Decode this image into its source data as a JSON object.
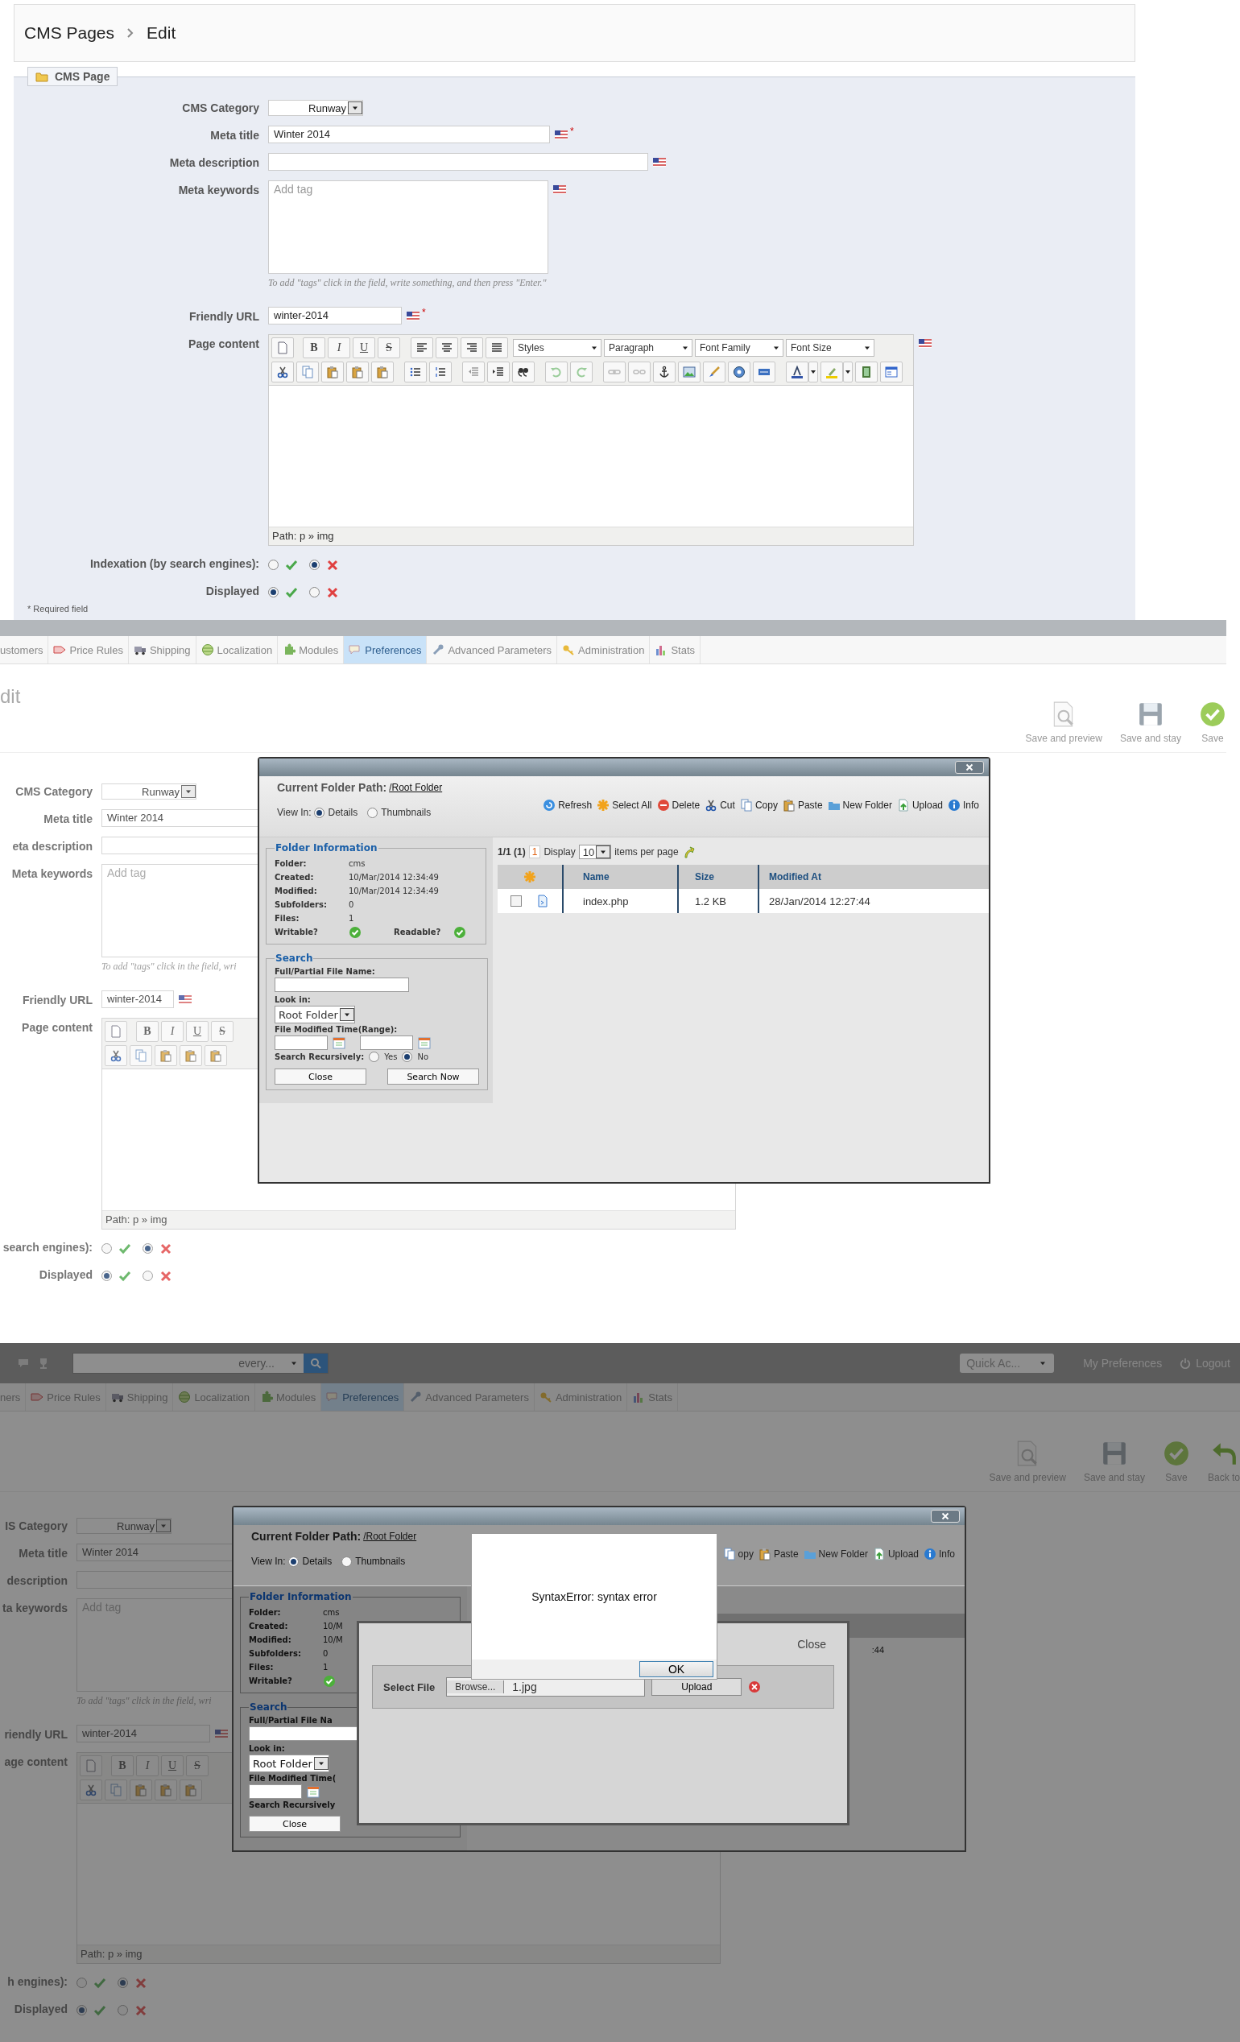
{
  "screens": [
    {
      "kind": "plain",
      "breadcrumb": [
        {
          "label": "CMS Pages"
        },
        {
          "label": "Edit"
        }
      ],
      "legend": "CMS Page",
      "form": {
        "category": {
          "label": "CMS Category",
          "value": "Runway"
        },
        "meta_title": {
          "label": "Meta title",
          "value": "Winter 2014",
          "required_mark": "*"
        },
        "meta_description": {
          "label": "Meta description"
        },
        "meta_keywords": {
          "label": "Meta keywords",
          "placeholder": "Add tag",
          "hint": "To add \"tags\" click in the field, write something, and then press \"Enter.\""
        },
        "friendly_url": {
          "label": "Friendly URL",
          "value": "winter-2014",
          "required_mark": "*"
        },
        "page_content": {
          "label": "Page content",
          "letters": [
            "B",
            "I",
            "U",
            "S"
          ],
          "formats": [
            "Styles",
            "Paragraph",
            "Font Family",
            "Font Size"
          ],
          "path": "Path: p » img"
        },
        "switches": [
          {
            "label": "Indexation (by search engines):",
            "options": [
              {
                "kind": "yes",
                "selected": false
              },
              {
                "kind": "no",
                "selected": true
              }
            ]
          },
          {
            "label": "Displayed",
            "options": [
              {
                "kind": "yes",
                "selected": true
              },
              {
                "kind": "no",
                "selected": false
              }
            ]
          }
        ]
      },
      "required_note": "* Required field"
    },
    {
      "kind": "light",
      "tabs": [
        {
          "label": "ustomers",
          "selected": false
        },
        {
          "label": "Price Rules",
          "selected": false
        },
        {
          "label": "Shipping",
          "selected": false
        },
        {
          "label": "Localization",
          "selected": false
        },
        {
          "label": "Modules",
          "selected": false
        },
        {
          "label": "Preferences",
          "selected": true
        },
        {
          "label": "Advanced Parameters",
          "selected": false
        },
        {
          "label": "Administration",
          "selected": false
        },
        {
          "label": "Stats",
          "selected": false
        }
      ],
      "title": "dit",
      "actions": [
        {
          "label": "Save and preview",
          "kind": "preview"
        },
        {
          "label": "Save and stay",
          "kind": "stay"
        },
        {
          "label": "Save",
          "kind": "save"
        }
      ],
      "form": {
        "category": {
          "label": "CMS Category",
          "value": "Runway"
        },
        "meta_title": {
          "label": "Meta title",
          "value": "Winter 2014"
        },
        "meta_description": {
          "label": "eta description"
        },
        "meta_keywords": {
          "label": "Meta keywords",
          "placeholder": "Add tag",
          "hint": "To add \"tags\" click in the field, wri"
        },
        "friendly_url": {
          "label": "Friendly URL",
          "value": "winter-2014"
        },
        "page_content": {
          "label": "Page content",
          "letters": [
            "B",
            "I",
            "U",
            "S"
          ],
          "path": "Path: p » img"
        },
        "switches": [
          {
            "label": "search engines):",
            "options": [
              {
                "kind": "yes",
                "selected": false
              },
              {
                "kind": "no",
                "selected": true
              }
            ]
          },
          {
            "label": "Displayed",
            "options": [
              {
                "kind": "yes",
                "selected": true
              },
              {
                "kind": "no",
                "selected": false
              }
            ]
          }
        ]
      },
      "file_manager": {
        "path_label": "Current Folder Path:",
        "path_link": "/Root Folder",
        "view_in": {
          "label": "View In:",
          "options": [
            {
              "label": "Details",
              "selected": true
            },
            {
              "label": "Thumbnails",
              "selected": false
            }
          ]
        },
        "actions": [
          {
            "label": "Refresh",
            "kind": "refresh"
          },
          {
            "label": "Select All",
            "kind": "select_all"
          },
          {
            "label": "Delete",
            "kind": "delete"
          },
          {
            "label": "Cut",
            "kind": "cut"
          },
          {
            "label": "Copy",
            "kind": "copy"
          },
          {
            "label": "Paste",
            "kind": "paste"
          },
          {
            "label": "New Folder",
            "kind": "new_folder"
          },
          {
            "label": "Upload",
            "kind": "upload"
          },
          {
            "label": "Info",
            "kind": "info"
          }
        ],
        "folder_info": {
          "title": "Folder Information",
          "rows": [
            {
              "label": "Folder:",
              "value": "cms"
            },
            {
              "label": "Created:",
              "value": "10/Mar/2014 12:34:49"
            },
            {
              "label": "Modified:",
              "value": "10/Mar/2014 12:34:49"
            },
            {
              "label": "Subfolders:",
              "value": "0"
            },
            {
              "label": "Files:",
              "value": "1"
            }
          ],
          "writable": "Writable?",
          "readable": "Readable?"
        },
        "search": {
          "title": "Search",
          "name_label": "Full/Partial File Name:",
          "look_in_label": "Look in:",
          "look_in_value": "Root Folder",
          "time_label": "File Modified Time(Range):",
          "recursive_label": "Search Recursively:",
          "recursive_options": [
            {
              "label": "Yes",
              "selected": false
            },
            {
              "label": "No",
              "selected": true
            }
          ],
          "buttons": [
            "Close",
            "Search Now"
          ]
        },
        "pager": {
          "count": "1/1 (1)",
          "page": "1",
          "display": "Display",
          "per_page": "10",
          "suffix": "items per page"
        },
        "columns": [
          "Name",
          "Size",
          "Modified At"
        ],
        "rows": [
          {
            "checked": false,
            "name": "index.php",
            "size": "1.2 KB",
            "modified": "28/Jan/2014 12:27:44"
          }
        ]
      }
    },
    {
      "kind": "dimmed",
      "top_bar": {
        "search_scope": "every...",
        "quick_access": "Quick Ac...",
        "links": [
          {
            "label": "My Preferences",
            "kind": "text"
          },
          {
            "label": "Logout",
            "kind": "logout"
          }
        ]
      },
      "tabs": [
        {
          "label": "ners",
          "selected": false
        },
        {
          "label": "Price Rules",
          "selected": false
        },
        {
          "label": "Shipping",
          "selected": false
        },
        {
          "label": "Localization",
          "selected": false
        },
        {
          "label": "Modules",
          "selected": false
        },
        {
          "label": "Preferences",
          "selected": true
        },
        {
          "label": "Advanced Parameters",
          "selected": false
        },
        {
          "label": "Administration",
          "selected": false
        },
        {
          "label": "Stats",
          "selected": false
        }
      ],
      "actions": [
        {
          "label": "Save and preview",
          "kind": "preview"
        },
        {
          "label": "Save and stay",
          "kind": "stay"
        },
        {
          "label": "Save",
          "kind": "save"
        },
        {
          "label": "Back to",
          "kind": "back"
        }
      ],
      "form": {
        "category": {
          "label": "IS Category",
          "value": "Runway"
        },
        "meta_title": {
          "label": "Meta title",
          "value": "Winter 2014"
        },
        "meta_description": {
          "label": "description"
        },
        "meta_keywords": {
          "label": "ta keywords",
          "placeholder": "Add tag",
          "hint": "To add \"tags\" click in the field, wri"
        },
        "friendly_url": {
          "label": "riendly URL",
          "value": "winter-2014"
        },
        "page_content": {
          "label": "age content",
          "letters": [
            "B",
            "I",
            "U",
            "S"
          ],
          "path": "Path: p » img"
        },
        "switches": [
          {
            "label": "h engines):",
            "options": [
              {
                "kind": "yes",
                "selected": false
              },
              {
                "kind": "no",
                "selected": true
              }
            ]
          },
          {
            "label": "Displayed",
            "options": [
              {
                "kind": "yes",
                "selected": true
              },
              {
                "kind": "no",
                "selected": false
              }
            ]
          }
        ]
      },
      "file_manager": {
        "path_label": "Current Folder Path:",
        "path_link": "/Root Folder",
        "view_in": {
          "label": "View In:",
          "options": [
            {
              "label": "Details",
              "selected": true
            },
            {
              "label": "Thumbnails",
              "selected": false
            }
          ]
        },
        "actions": [
          {
            "label": "opy",
            "kind": "copy"
          },
          {
            "label": "Paste",
            "kind": "paste"
          },
          {
            "label": "New Folder",
            "kind": "new_folder"
          },
          {
            "label": "Upload",
            "kind": "upload"
          },
          {
            "label": "Info",
            "kind": "info"
          }
        ],
        "folder_info": {
          "title": "Folder Information",
          "rows": [
            {
              "label": "Folder:",
              "value": "cms"
            },
            {
              "label": "Created:",
              "value": "10/M"
            },
            {
              "label": "Modified:",
              "value": "10/M"
            },
            {
              "label": "Subfolders:",
              "value": "0"
            },
            {
              "label": "Files:",
              "value": "1"
            }
          ],
          "writable": "Writable?"
        },
        "search": {
          "title": "Search",
          "name_label": "Full/Partial File Na",
          "look_in_label": "Look in:",
          "look_in_value": "Root Folder",
          "time_label": "File Modified Time(",
          "recursive_label": "Search Recursively",
          "buttons": [
            "Close"
          ]
        },
        "rows": [
          {
            "modified": ":44"
          }
        ]
      },
      "upload_dialog": {
        "close": "Close",
        "label": "Select File",
        "browse": "Browse...",
        "file": "1.jpg",
        "upload": "Upload"
      },
      "alert": {
        "message": "SyntaxError: syntax error",
        "ok": "OK"
      }
    }
  ]
}
